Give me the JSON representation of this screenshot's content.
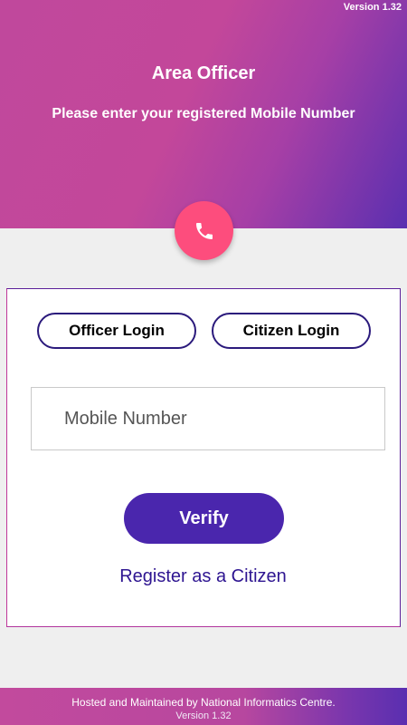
{
  "header": {
    "version": "Version 1.32",
    "title": "Area Officer",
    "subtitle": "Please enter your registered Mobile Number"
  },
  "fab": {
    "icon": "phone-icon"
  },
  "login_tabs": {
    "officer": "Officer Login",
    "citizen": "Citizen Login"
  },
  "mobile_field": {
    "placeholder": "Mobile Number",
    "value": ""
  },
  "verify_label": "Verify",
  "register_link": "Register as a Citizen",
  "footer": {
    "hosted_text": "Hosted and Maintained by National Informatics Centre.",
    "version": "Version 1.32"
  },
  "colors": {
    "header_gradient_start": "#c0489c",
    "header_gradient_end": "#5a2fb0",
    "fab": "#fd4d7d",
    "verify_button": "#4a26ad",
    "link": "#2e1591",
    "pill_border": "#2b1a7c"
  }
}
